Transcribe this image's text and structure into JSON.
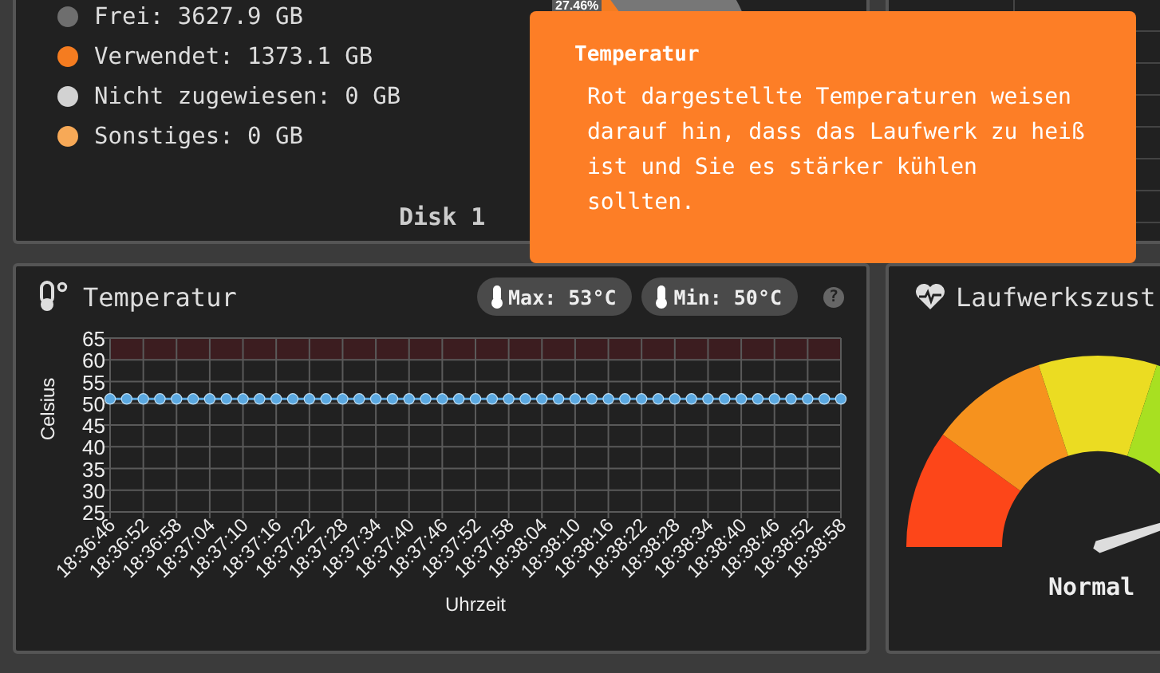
{
  "disk_card": {
    "legend": [
      {
        "label": "Frei: 3627.9 GB",
        "color": "#6e6e6e"
      },
      {
        "label": "Verwendet: 1373.1 GB",
        "color": "#f57c20"
      },
      {
        "label": "Nicht zugewiesen: 0 GB",
        "color": "#d2d2d2"
      },
      {
        "label": "Sonstiges: 0 GB",
        "color": "#f7a957"
      }
    ],
    "usage_label": "27.46%",
    "disk_label": "Disk 1"
  },
  "temperature_card": {
    "title": "Temperatur",
    "max_badge": "Max: 53°C",
    "min_badge": "Min: 50°C",
    "help": "?",
    "chart_data": {
      "type": "line",
      "xlabel": "Uhrzeit",
      "ylabel": "Celsius",
      "categories": [
        "18:36:46",
        null,
        "18:36:52",
        null,
        "18:36:58",
        null,
        "18:37:04",
        null,
        "18:37:10",
        null,
        "18:37:16",
        null,
        "18:37:22",
        null,
        "18:37:28",
        null,
        "18:37:34",
        null,
        "18:37:40",
        null,
        "18:37:46",
        null,
        "18:37:52",
        null,
        "18:37:58",
        null,
        "18:38:04",
        null,
        "18:38:10",
        null,
        "18:38:16",
        null,
        "18:38:22",
        null,
        "18:38:28",
        null,
        "18:38:34",
        null,
        "18:38:40",
        null,
        "18:38:46",
        null,
        "18:38:52",
        null,
        "18:38:58"
      ],
      "grid": true,
      "series": [
        {
          "color": "#5ba8e0",
          "marker": true,
          "values": [
            51,
            51,
            51,
            51,
            51,
            51,
            51,
            51,
            51,
            51,
            51,
            51,
            51,
            51,
            51,
            51,
            51,
            51,
            51,
            51,
            51,
            51,
            51,
            51,
            51,
            51,
            51,
            51,
            51,
            51,
            51,
            51,
            51,
            51,
            51,
            51,
            51,
            51,
            51,
            51,
            51,
            51,
            51,
            51,
            51
          ]
        }
      ],
      "ylim": [
        25,
        65
      ],
      "yticks": [
        25,
        30,
        35,
        40,
        45,
        50,
        55,
        60,
        65
      ],
      "bands": [
        {
          "axis": "y",
          "from": 60,
          "to": 65,
          "color": "#3c1d20"
        }
      ]
    }
  },
  "health_card": {
    "title": "Laufwerkszust",
    "status": "Normal",
    "level": 0.9
  },
  "tooltip": {
    "title": "Temperatur",
    "text": "Rot dargestellte Temperaturen weisen darauf hin, dass das Laufwerk zu heiß ist und Sie es stärker kühlen sollten."
  }
}
